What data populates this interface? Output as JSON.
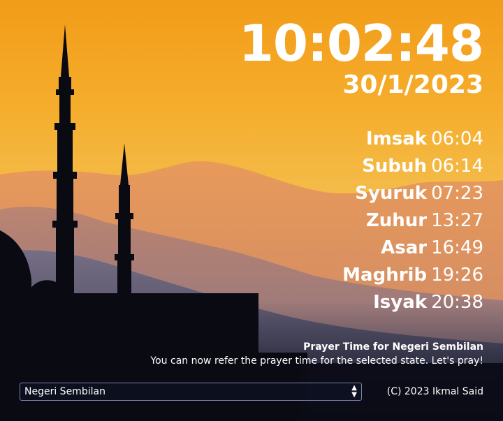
{
  "clock": {
    "time": "10:02:48",
    "date": "30/1/2023"
  },
  "prayers": [
    {
      "name": "Imsak",
      "time": "06:04"
    },
    {
      "name": "Subuh",
      "time": "06:14"
    },
    {
      "name": "Syuruk",
      "time": "07:23"
    },
    {
      "name": "Zuhur",
      "time": "13:27"
    },
    {
      "name": "Asar",
      "time": "16:49"
    },
    {
      "name": "Maghrib",
      "time": "19:26"
    },
    {
      "name": "Isyak",
      "time": "20:38"
    }
  ],
  "info": {
    "title": "Prayer Time for Negeri Sembilan",
    "description": "You can now refer the prayer time for the selected state. Let's pray!"
  },
  "state_select": {
    "selected": "Negeri Sembilan"
  },
  "footer": {
    "copyright": "(C) 2023 Ikmal Said"
  },
  "colors": {
    "sky_top": "#f5a623",
    "sky_mid": "#f2b23a",
    "horizon": "#f4c35a",
    "silhouette": "#0a0a12"
  }
}
